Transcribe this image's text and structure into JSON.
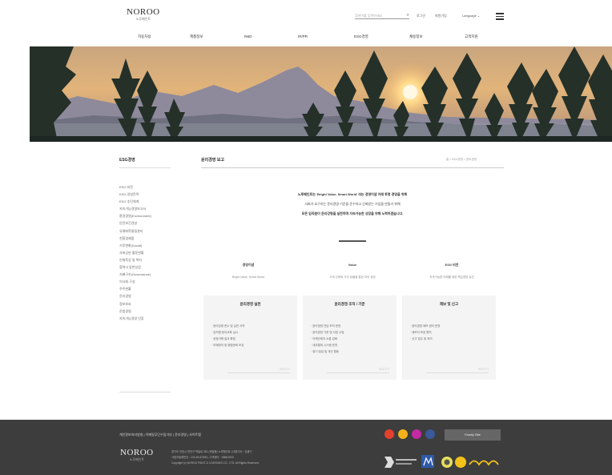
{
  "header": {
    "logo_en": "NOROO",
    "logo_ko": "노루페인트",
    "search_placeholder": "검색어를 입력하세요",
    "util_links": [
      "로그인",
      "회원가입"
    ],
    "language": "Language",
    "gnb": [
      "자동차용",
      "제품정보",
      "R&D",
      "IR/PR",
      "ESG경영",
      "채용정보",
      "고객지원"
    ]
  },
  "lnb": {
    "title": "ESG경영",
    "items": [
      "ESG 비전",
      "ESG 경영전략",
      "ESG 추진체계",
      "지속가능경영보고서",
      "환경경영(Environment)",
      "안전보건경영",
      "유해화학물질관리",
      "친환경제품",
      "기후변화(Social)",
      "사회공헌 활동현황",
      "인재육성 및 복지",
      "협력사 동반성장",
      "지배구조(Governance)",
      "이사회 구성",
      "주주현황",
      "윤리경영",
      "정보보호",
      "준법경영",
      "지속가능경영 인증"
    ]
  },
  "content": {
    "title": "윤리경영 보고",
    "breadcrumb": "홈 > ESG경영 > 윤리경영",
    "intro": [
      "노루페인트는 'Bright Value, Smart World' 라는 경영이념 아래 투명 경영을 위해",
      "사회가 요구하는 윤리경영 기준을 준수하고 신뢰받는 기업을 만들기 위해",
      "모든 임직원이 윤리강령을 실천하며 지속가능한 성장을 위해 노력하겠습니다."
    ],
    "columns": [
      {
        "head": "경영이념",
        "sub": "Bright Value, Smart World"
      },
      {
        "head": "Value",
        "sub": "고객 신뢰와 가치 창출을 통한 지속 성장"
      },
      {
        "head": "ESG 비전",
        "sub": "지속가능한 미래를 위한 책임경영 실천"
      }
    ],
    "cards": [
      {
        "title": "윤리경영 실천",
        "items": [
          "· 윤리강령 준수 및 실천 서약",
          "· 임직원 윤리교육 실시",
          "· 공정거래 질서 확립",
          "· 부패방지 및 청렴문화 조성"
        ]
      },
      {
        "title": "윤리경영 조직 / 기준",
        "items": [
          "· 윤리경영 전담 조직 운영",
          "· 윤리경영 기준 및 지침 수립",
          "· 이해관계자 소통 강화",
          "· 내부통제 시스템 운영",
          "· 정기 점검 및 개선 활동"
        ]
      },
      {
        "title": "제보 및 신고",
        "items": [
          "· 윤리경영 제보 센터 운영",
          "· 제보자 보호 원칙",
          "· 신고 접수 및 처리"
        ]
      }
    ],
    "card_link": "바로가기"
  },
  "footer": {
    "links": "개인정보처리방침  |  이메일무단수집거부  |  윤리경영  |  사이트맵",
    "family_site": "Family Site",
    "logo_en": "NOROO",
    "logo_ko": "노루페인트",
    "address": [
      "경기도 안양시 만안구 박달로 351 (박달동) 노루페인트 | 대표이사 : 김용기",
      "사업자등록번호 : 123-45-67890 | 고객센터 : 1588-0000",
      "Copyright (c) NOROO PAINT & COATINGS CO., LTD. All Rights Reserved."
    ],
    "sns_colors": [
      "#e4402e",
      "#f3b21b",
      "#c32aa3",
      "#3b5998"
    ]
  }
}
